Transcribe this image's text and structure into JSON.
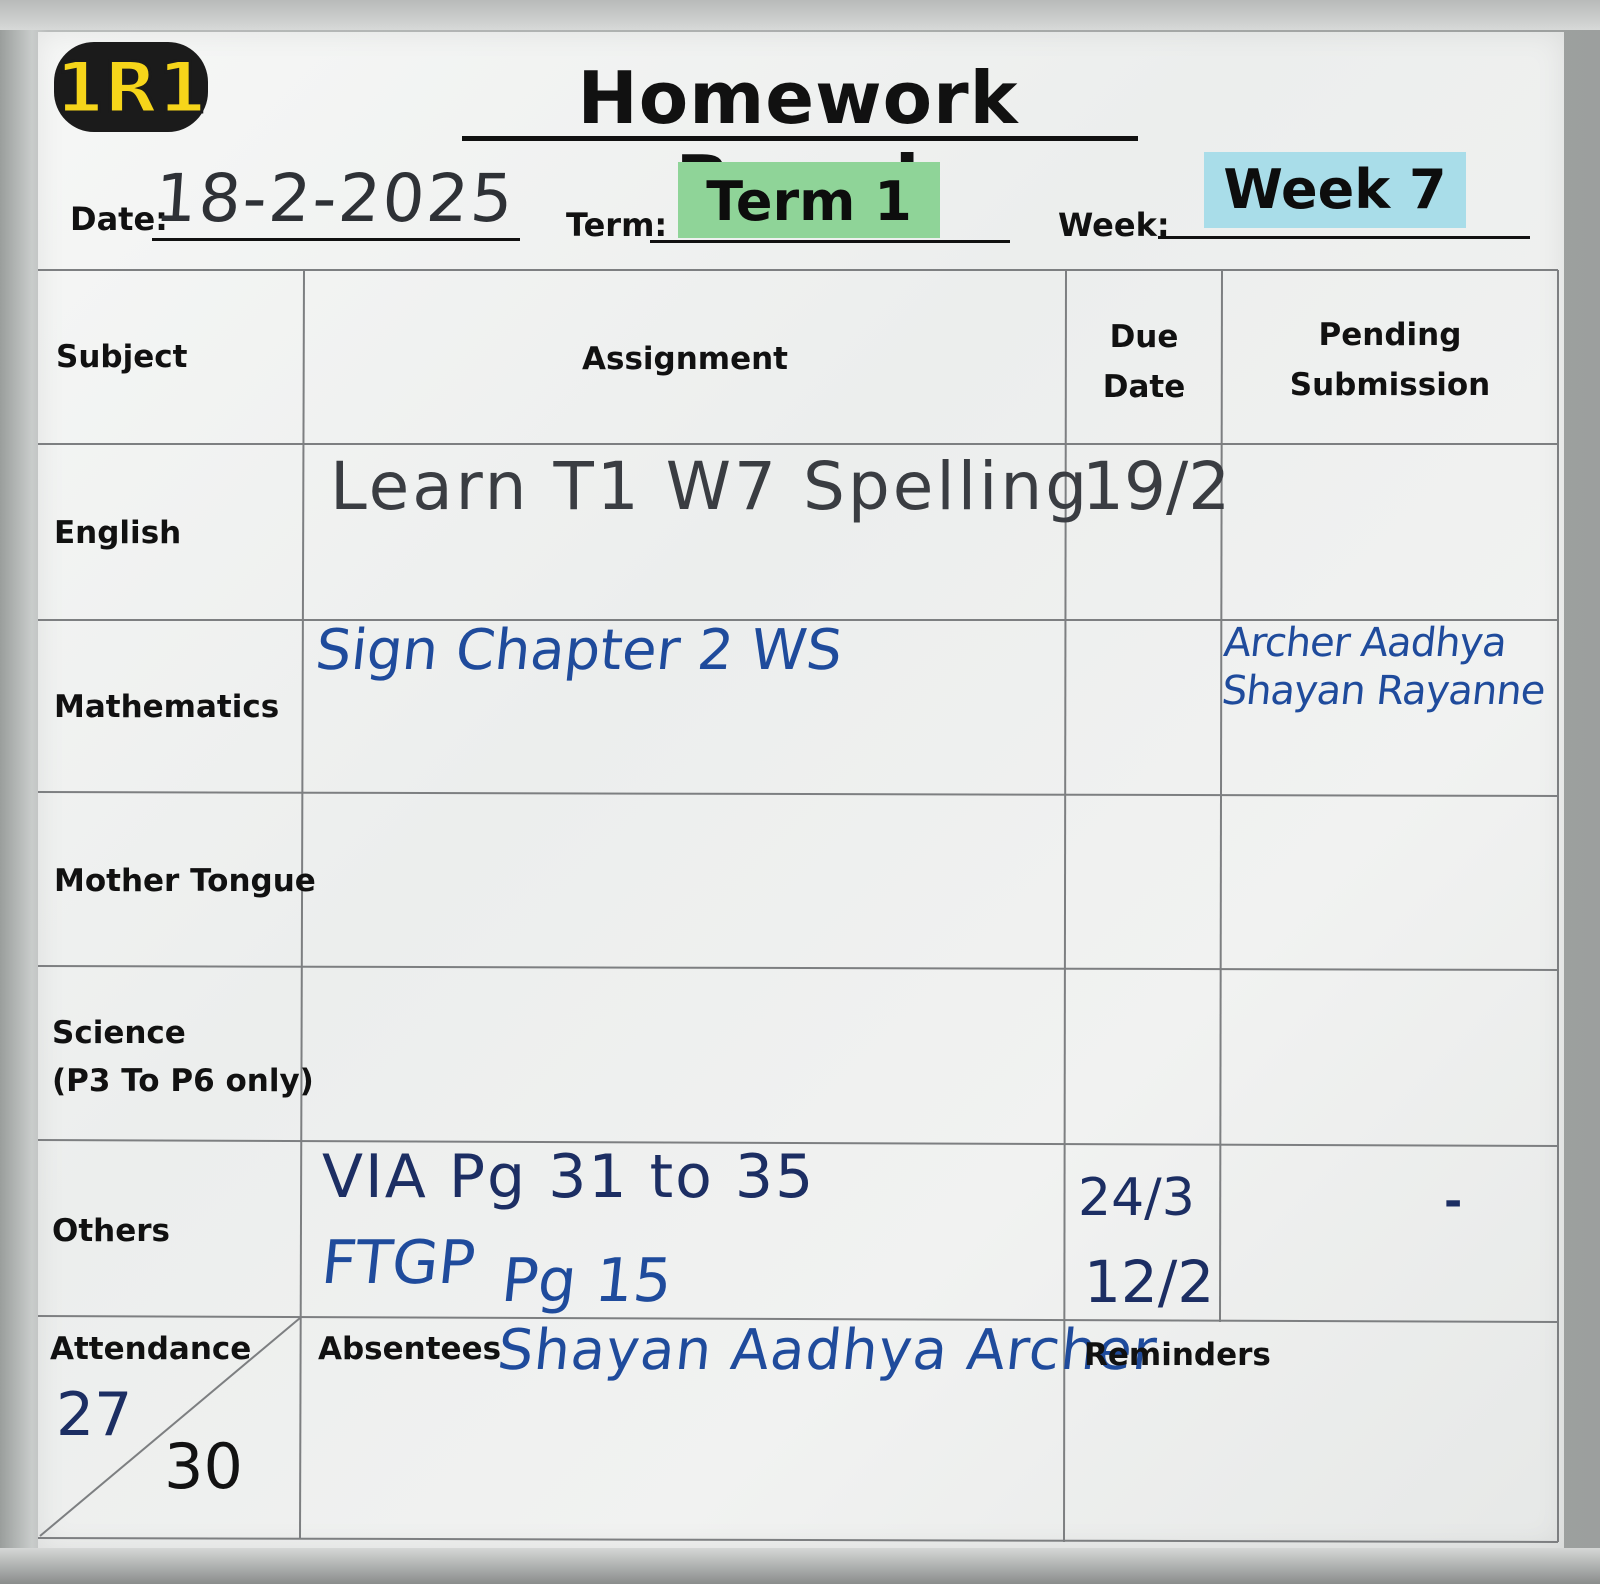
{
  "board": {
    "logo_text": "1R1",
    "title": "Homework Board",
    "date_label": "Date:",
    "date_value": "18-2-2025",
    "term_label": "Term:",
    "term_value": "Term 1",
    "week_label": "Week:",
    "week_value": "Week 7"
  },
  "table": {
    "columns": {
      "subject": "Subject",
      "assignment": "Assignment",
      "due_date_line1": "Due",
      "due_date_line2": "Date",
      "pending_line1": "Pending",
      "pending_line2": "Submission"
    },
    "rows": {
      "english": {
        "subject": "English",
        "assignment": "Learn T1 W7 Spelling",
        "due": "19/2"
      },
      "mathematics": {
        "subject": "Mathematics",
        "assignment": "Sign Chapter 2 WS",
        "pending_line1": "Archer Aadhya",
        "pending_line2": "Shayan Rayanne"
      },
      "mother_tongue": {
        "subject": "Mother Tongue"
      },
      "science": {
        "subject_line1": "Science",
        "subject_line2": "(P3 To P6 only)"
      },
      "others": {
        "subject": "Others",
        "assignment_line1": "VIA Pg 31 to 35",
        "assignment_line2a": "FTGP",
        "assignment_line2b": "Pg 15",
        "due_line1": "24/3",
        "due_line2": "12/2",
        "pending": "-"
      }
    },
    "attendance": {
      "label": "Attendance",
      "present": "27",
      "total": "30"
    },
    "absentees": {
      "label": "Absentees",
      "names": "Shayan Aadhya Archer"
    },
    "reminders": {
      "label": "Reminders"
    }
  }
}
